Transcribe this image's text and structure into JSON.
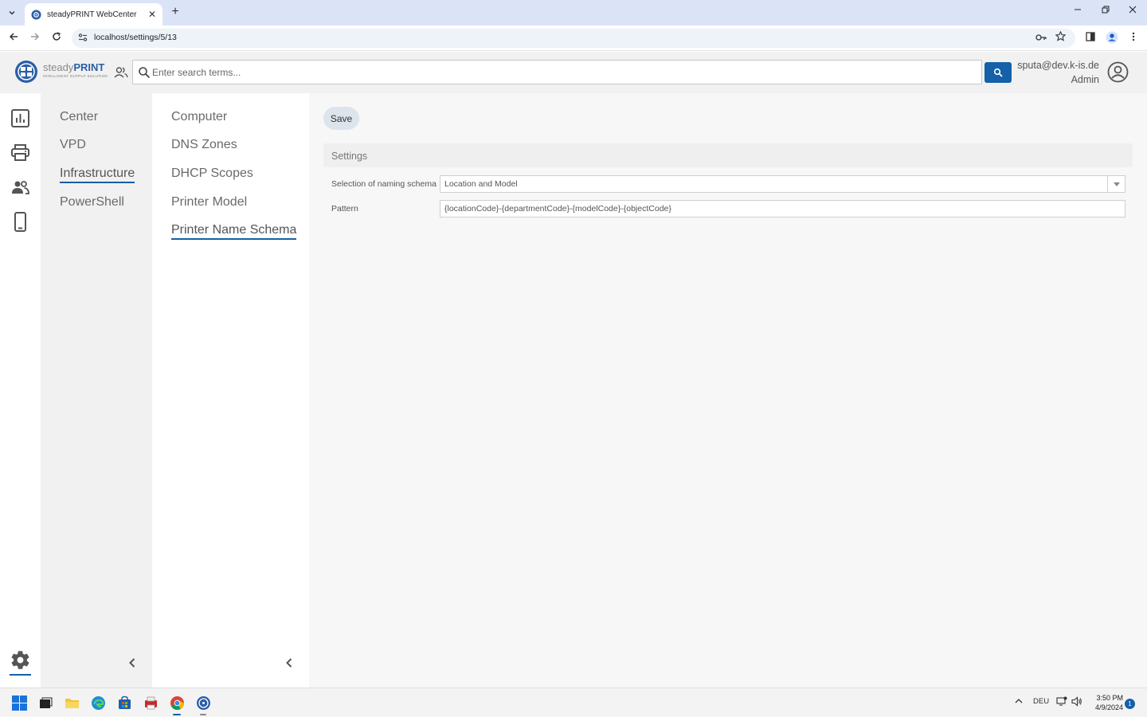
{
  "browser": {
    "tab_title": "steadyPRINT WebCenter",
    "url": "localhost/settings/5/13",
    "new_tab_symbol": "+",
    "close_tab_symbol": "✕"
  },
  "app": {
    "logo_main": "steady",
    "logo_bold": "PRINT",
    "logo_tagline": "INTELLIGENT OUTPUT SOLUTION",
    "search_placeholder": "Enter search terms...",
    "user_email": "sputa@dev.k-is.de",
    "user_role": "Admin"
  },
  "rail": {
    "items": [
      "dashboard-chart-icon",
      "printer-icon",
      "users-icon",
      "mobile-device-icon"
    ],
    "bottom": "settings-gear-icon"
  },
  "nav1": {
    "items": [
      {
        "label": "Center",
        "active": false
      },
      {
        "label": "VPD",
        "active": false
      },
      {
        "label": "Infrastructure",
        "active": true
      },
      {
        "label": "PowerShell",
        "active": false
      }
    ]
  },
  "nav2": {
    "items": [
      {
        "label": "Computer",
        "active": false
      },
      {
        "label": "DNS Zones",
        "active": false
      },
      {
        "label": "DHCP Scopes",
        "active": false
      },
      {
        "label": "Printer Model",
        "active": false
      },
      {
        "label": "Printer Name Schema",
        "active": true
      }
    ]
  },
  "main": {
    "save_label": "Save",
    "panel_title": "Settings",
    "naming_label": "Selection of naming schema",
    "naming_value": "Location and Model",
    "pattern_label": "Pattern",
    "pattern_value": "{locationCode}-{departmentCode}-{modelCode}-{objectCode}"
  },
  "taskbar": {
    "language": "DEU",
    "time": "3:50 PM",
    "date": "4/9/2024",
    "notification_count": "1"
  },
  "colors": {
    "accent": "#1560a8",
    "sidebar_bg": "#f1f1f1",
    "main_bg": "#f7f7f7"
  }
}
